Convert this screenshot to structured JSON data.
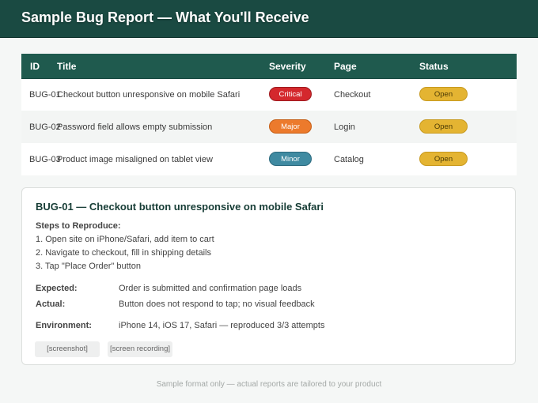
{
  "header": {
    "title": "Sample Bug Report — What You'll Receive"
  },
  "table": {
    "columns": [
      "ID",
      "Title",
      "Severity",
      "Page",
      "Status"
    ],
    "rows": [
      {
        "id": "BUG-01",
        "title": "Checkout button unresponsive on mobile Safari",
        "severity": "Critical",
        "page": "Checkout",
        "status": "Open"
      },
      {
        "id": "BUG-02",
        "title": "Password field allows empty submission",
        "severity": "Major",
        "page": "Login",
        "status": "Open"
      },
      {
        "id": "BUG-03",
        "title": "Product image misaligned on tablet view",
        "severity": "Minor",
        "page": "Catalog",
        "status": "Open"
      }
    ]
  },
  "detail": {
    "title": "BUG-01 — Checkout button unresponsive on mobile Safari",
    "steps_label": "Steps to Reproduce:",
    "steps": [
      "1. Open site on iPhone/Safari, add item to cart",
      "2. Navigate to checkout, fill in shipping details",
      "3. Tap \"Place Order\" button"
    ],
    "expected_label": "Expected:",
    "expected_value": "Order is submitted and confirmation page loads",
    "actual_label": "Actual:",
    "actual_value": "Button does not respond to tap; no visual feedback",
    "environment_label": "Environment:",
    "environment_value": "iPhone 14, iOS 17, Safari — reproduced 3/3 attempts",
    "attachments": [
      "[screenshot]",
      "[screen recording]"
    ]
  },
  "footer": {
    "note": "Sample format only — actual reports are tailored to your product"
  },
  "colors": {
    "header_bg": "#1a4a42",
    "table_header_bg": "#1f5a4e",
    "critical": "#d4282d",
    "major": "#ec7a2c",
    "minor": "#3f8aa1",
    "open": "#e4b432"
  }
}
